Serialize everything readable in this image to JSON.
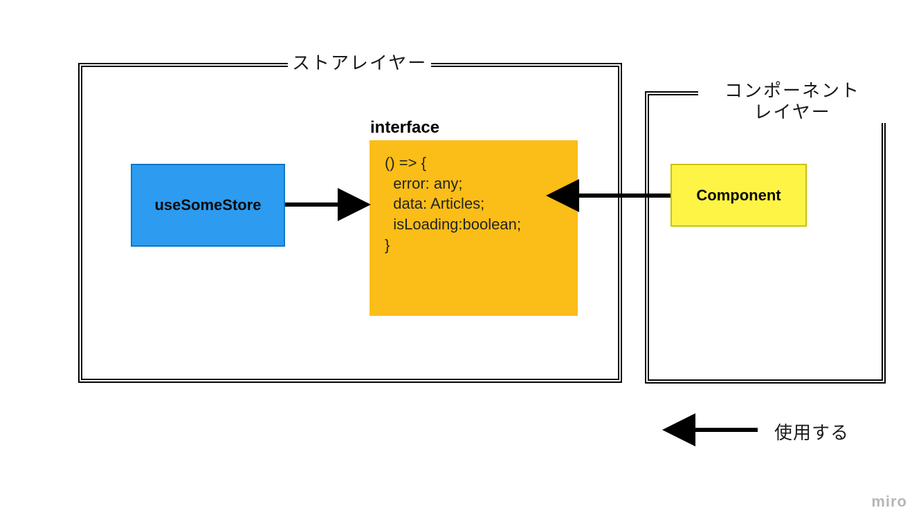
{
  "storeLayer": {
    "title": "ストアレイヤー"
  },
  "componentLayer": {
    "titleLine1": "コンポーネント",
    "titleLine2": "レイヤー"
  },
  "nodes": {
    "useSomeStore": "useSomeStore",
    "interfaceTitle": "interface",
    "interfaceBody": "() => {\n  error: any;\n  data: Articles;\n  isLoading:boolean;\n}",
    "component": "Component"
  },
  "legend": {
    "uses": "使用する"
  },
  "watermark": "miro"
}
